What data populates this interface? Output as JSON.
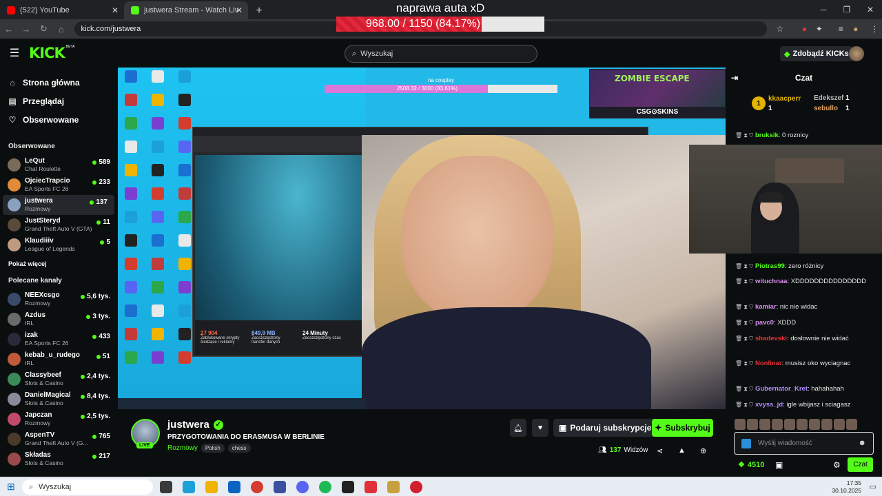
{
  "browser": {
    "tabs": [
      {
        "title": "(522) YouTube",
        "active": false
      },
      {
        "title": "justwera Stream - Watch Liv",
        "active": true
      }
    ],
    "url": "kick.com/justwera"
  },
  "goal_overlay": {
    "title": "naprawa auta xD",
    "text": "968.00 / 1150 (84.17%)",
    "progress": 0.8417
  },
  "header": {
    "logo": "KICK",
    "beta": "BETA",
    "search_placeholder": "Wyszukaj",
    "kicks_button": "Zdobądź KICKs"
  },
  "sidebar": {
    "nav": [
      {
        "label": "Strona główna",
        "icon": "home-icon"
      },
      {
        "label": "Przeglądaj",
        "icon": "browse-icon"
      },
      {
        "label": "Obserwowane",
        "icon": "heart-icon"
      }
    ],
    "followed_title": "Obserwowane",
    "followed": [
      {
        "name": "LeQut",
        "category": "Chat Roulette",
        "viewers": "589",
        "color": "#7a6a5a"
      },
      {
        "name": "OjciecTrapcio",
        "category": "EA Sports FC 26",
        "viewers": "233",
        "color": "#e08a3a"
      },
      {
        "name": "justwera",
        "category": "Rozmowy",
        "viewers": "137",
        "color": "#8aa0c0"
      },
      {
        "name": "JustSteryd",
        "category": "Grand Theft Auto V (GTA)",
        "viewers": "11",
        "color": "#5a4a3a"
      },
      {
        "name": "Klaudiiiv",
        "category": "League of Legends",
        "viewers": "5",
        "color": "#c09a80"
      }
    ],
    "show_more": "Pokaż więcej",
    "recommended_title": "Polecane kanały",
    "recommended": [
      {
        "name": "NEEXcsgo",
        "category": "Rozmowy",
        "viewers": "5,6 tys.",
        "color": "#3a4a6a"
      },
      {
        "name": "Azdus",
        "category": "IRL",
        "viewers": "3 tys.",
        "color": "#6a6a6a"
      },
      {
        "name": "izak",
        "category": "EA Sports FC 26",
        "viewers": "433",
        "color": "#2a2a3a"
      },
      {
        "name": "kebab_u_rudego",
        "category": "IRL",
        "viewers": "51",
        "color": "#c05a3a"
      },
      {
        "name": "Classybeef",
        "category": "Slots & Casino",
        "viewers": "2,4 tys.",
        "color": "#3a8a5a"
      },
      {
        "name": "DanielMagical",
        "category": "Slots & Casino",
        "viewers": "8,4 tys.",
        "color": "#8a8a9a"
      },
      {
        "name": "Japczan",
        "category": "Rozmowy",
        "viewers": "2,5 tys.",
        "color": "#c04a6a"
      },
      {
        "name": "AspenTV",
        "category": "Grand Theft Auto V (G...",
        "viewers": "765",
        "color": "#4a3a2a"
      },
      {
        "name": "Składas",
        "category": "Slots & Casino",
        "viewers": "217",
        "color": "#9a4a4a"
      }
    ]
  },
  "video_overlays": {
    "cosplay_title": "na cosplay",
    "cosplay_text": "2508.32 / 3000 (83.61%)",
    "cosplay_progress": 0.8361,
    "zombie_title": "ZOMBIE ESCAPE",
    "zombie_sub": "CSG⊙SKINS",
    "stats": [
      {
        "value": "27 904",
        "label": "Zablokowane skrypty śledzące i reklamy"
      },
      {
        "value": "849,9 MB",
        "label": "Zaoszczędzony transfer danych"
      },
      {
        "value": "24 Minuty",
        "label": "Zaoszczędzony czas"
      }
    ]
  },
  "stream_info": {
    "name": "justwera",
    "title": "PRZYGOTOWANIA DO ERASMUSA W BERLINIE",
    "category": "Rozmowy",
    "tags": [
      "Polish",
      "chess"
    ],
    "live": "LIVE",
    "gift_button": "Podaruj subskrypcje",
    "subscribe_button": "Subskrybuj",
    "viewers_count": "137",
    "viewers_label": "Widzów"
  },
  "chat": {
    "title": "Czat",
    "leaders": [
      {
        "rank": "1",
        "name": "kkaacperr",
        "count": "1"
      },
      {
        "name": "Edekszef",
        "count": "1"
      },
      {
        "name": "sebullo",
        "count": "1"
      }
    ],
    "messages": [
      {
        "user": "bruksik",
        "text": ": 0 roznicy",
        "color": "#53fc18"
      },
      {
        "user": "Piotras99",
        "text": ": zero różnicy",
        "color": "#53fc18"
      },
      {
        "user": "wituchnaa",
        "text": ": XDDDDDDDDDDDDDDD",
        "color": "#d78cf2"
      },
      {
        "user": "kamiar",
        "text": ": nic nie widac",
        "color": "#d78cf2"
      },
      {
        "user": "pavc0",
        "text": ": XDDD",
        "color": "#d78cf2"
      },
      {
        "user": "shadevski",
        "text": ": dosłownie nie widać",
        "color": "#e8323a"
      },
      {
        "user": "Nonlinar",
        "text": ": musisz oko wyciagnac",
        "color": "#e8323a"
      },
      {
        "user": "Gubernator_Kret",
        "text": ": hahahahah",
        "color": "#b48cff"
      },
      {
        "user": "xvyss_jd",
        "text": ": igle wbijasz i sciagasz",
        "color": "#b48cff"
      }
    ],
    "input_placeholder": "Wyślij wiadomość",
    "points": "4510",
    "send_button": "Czat"
  },
  "taskbar": {
    "search": "Wyszukaj",
    "time": "17:35",
    "date": "30.10.2025"
  }
}
